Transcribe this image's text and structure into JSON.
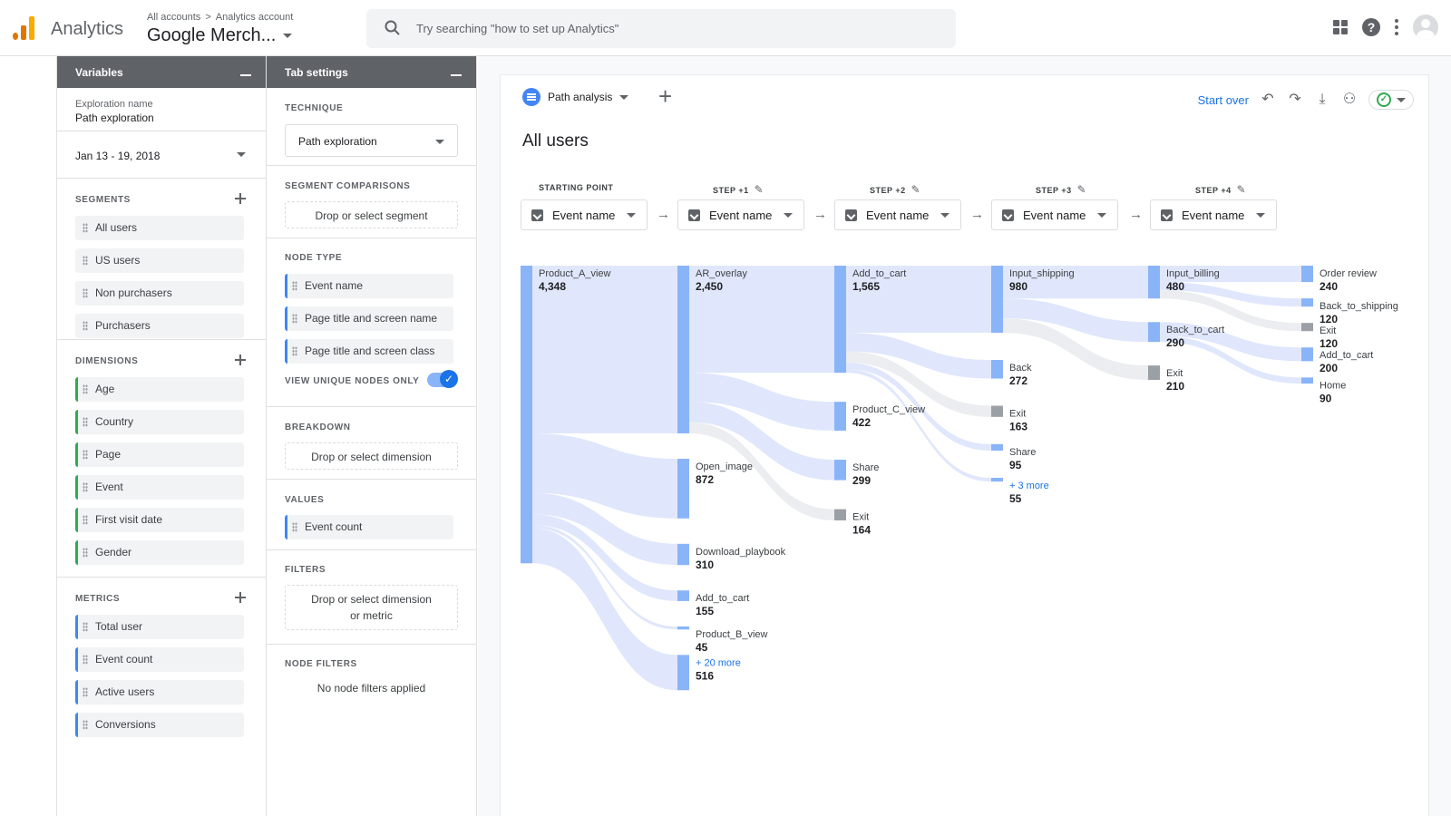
{
  "header": {
    "app_name": "Analytics",
    "breadcrumb": [
      "All accounts",
      "Analytics account"
    ],
    "breadcrumb_sep": ">",
    "account_name": "Google Merch...",
    "search_placeholder": "Try searching \"how to set up Analytics\""
  },
  "variables": {
    "title": "Variables",
    "exploration_label": "Exploration name",
    "exploration_name": "Path exploration",
    "date_range": "Jan 13 - 19, 2018",
    "segments_title": "SEGMENTS",
    "segments": [
      "All users",
      "US users",
      "Non purchasers",
      "Purchasers"
    ],
    "dimensions_title": "DIMENSIONS",
    "dimensions": [
      "Age",
      "Country",
      "Page",
      "Event",
      "First visit date",
      "Gender"
    ],
    "metrics_title": "METRICS",
    "metrics": [
      "Total user",
      "Event count",
      "Active users",
      "Conversions"
    ]
  },
  "tab_settings": {
    "title": "Tab settings",
    "technique_title": "TECHNIQUE",
    "technique": "Path exploration",
    "segment_comparisons_title": "SEGMENT COMPARISONS",
    "segment_drop": "Drop or select segment",
    "node_type_title": "NODE TYPE",
    "node_types": [
      "Event name",
      "Page title and screen name",
      "Page title and screen class"
    ],
    "unique_nodes_label": "VIEW UNIQUE NODES ONLY",
    "unique_nodes_on": true,
    "breakdown_title": "BREAKDOWN",
    "breakdown_drop": "Drop or select dimension",
    "values_title": "VALUES",
    "value": "Event count",
    "filters_title": "FILTERS",
    "filters_drop_1": "Drop or select dimension",
    "filters_drop_2": "or metric",
    "node_filters_title": "NODE FILTERS",
    "node_filters_text": "No node filters applied"
  },
  "canvas": {
    "tab_name": "Path analysis",
    "start_over": "Start over",
    "title": "All users",
    "steps": [
      {
        "label": "STARTING POINT",
        "dropdown": "Event name",
        "editable": false
      },
      {
        "label": "STEP +1",
        "dropdown": "Event name",
        "editable": true
      },
      {
        "label": "STEP +2",
        "dropdown": "Event name",
        "editable": true
      },
      {
        "label": "STEP +3",
        "dropdown": "Event name",
        "editable": true
      },
      {
        "label": "STEP +4",
        "dropdown": "Event name",
        "editable": true
      }
    ]
  },
  "chart_data": {
    "type": "sankey",
    "colors": {
      "node": "#8ab4f8",
      "exit": "#9aa0a6",
      "link": "#dbe3fb",
      "more": "#1a73e8"
    },
    "columns": [
      [
        {
          "id": "s0",
          "name": "Product_A_view",
          "value": 4348
        }
      ],
      [
        {
          "id": "a1",
          "name": "AR_overlay",
          "value": 2450
        },
        {
          "id": "a2",
          "name": "Open_image",
          "value": 872
        },
        {
          "id": "a3",
          "name": "Download_playbook",
          "value": 310
        },
        {
          "id": "a4",
          "name": "Add_to_cart",
          "value": 155
        },
        {
          "id": "a5",
          "name": "Product_B_view",
          "value": 45
        },
        {
          "id": "a6",
          "name": "+ 20 more",
          "value": 516,
          "more": true
        }
      ],
      [
        {
          "id": "b1",
          "name": "Add_to_cart",
          "value": 1565
        },
        {
          "id": "b2",
          "name": "Product_C_view",
          "value": 422
        },
        {
          "id": "b3",
          "name": "Share",
          "value": 299
        },
        {
          "id": "b4",
          "name": "Exit",
          "value": 164,
          "exit": true
        }
      ],
      [
        {
          "id": "c1",
          "name": "Input_shipping",
          "value": 980
        },
        {
          "id": "c2",
          "name": "Back",
          "value": 272
        },
        {
          "id": "c3",
          "name": "Exit",
          "value": 163,
          "exit": true
        },
        {
          "id": "c4",
          "name": "Share",
          "value": 95
        },
        {
          "id": "c5",
          "name": "+ 3 more",
          "value": 55,
          "more": true
        }
      ],
      [
        {
          "id": "d1",
          "name": "Input_billing",
          "value": 480
        },
        {
          "id": "d2",
          "name": "Back_to_cart",
          "value": 290
        },
        {
          "id": "d3",
          "name": "Exit",
          "value": 210,
          "exit": true
        }
      ],
      [
        {
          "id": "e1",
          "name": "Order review",
          "value": 240
        },
        {
          "id": "e2",
          "name": "Back_to_shipping",
          "value": 120
        },
        {
          "id": "e3",
          "name": "Exit",
          "value": 120,
          "exit": true
        },
        {
          "id": "e4",
          "name": "Add_to_cart",
          "value": 200
        },
        {
          "id": "e5",
          "name": "Home",
          "value": 90
        }
      ]
    ],
    "links": [
      {
        "from": "s0",
        "to": "a1",
        "value": 2450
      },
      {
        "from": "s0",
        "to": "a2",
        "value": 872
      },
      {
        "from": "s0",
        "to": "a3",
        "value": 310
      },
      {
        "from": "s0",
        "to": "a4",
        "value": 155
      },
      {
        "from": "s0",
        "to": "a5",
        "value": 45
      },
      {
        "from": "s0",
        "to": "a6",
        "value": 516
      },
      {
        "from": "a1",
        "to": "b1",
        "value": 1565
      },
      {
        "from": "a1",
        "to": "b2",
        "value": 422
      },
      {
        "from": "a1",
        "to": "b3",
        "value": 299
      },
      {
        "from": "a1",
        "to": "b4",
        "value": 164
      },
      {
        "from": "b1",
        "to": "c1",
        "value": 980
      },
      {
        "from": "b1",
        "to": "c2",
        "value": 272
      },
      {
        "from": "b1",
        "to": "c3",
        "value": 163
      },
      {
        "from": "b1",
        "to": "c4",
        "value": 95
      },
      {
        "from": "b1",
        "to": "c5",
        "value": 55
      },
      {
        "from": "c1",
        "to": "d1",
        "value": 480
      },
      {
        "from": "c1",
        "to": "d2",
        "value": 290
      },
      {
        "from": "c1",
        "to": "d3",
        "value": 210
      },
      {
        "from": "d1",
        "to": "e1",
        "value": 240
      },
      {
        "from": "d1",
        "to": "e2",
        "value": 120
      },
      {
        "from": "d1",
        "to": "e3",
        "value": 120
      },
      {
        "from": "d2",
        "to": "e4",
        "value": 200
      },
      {
        "from": "d2",
        "to": "e5",
        "value": 90
      }
    ]
  }
}
